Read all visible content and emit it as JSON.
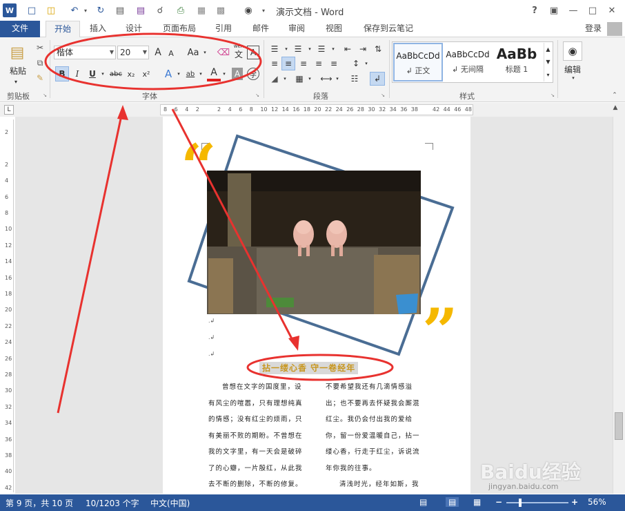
{
  "app": {
    "title": "演示文档 - Word",
    "help": "?",
    "login": "登录"
  },
  "tabs": [
    {
      "label": "文件"
    },
    {
      "label": "开始"
    },
    {
      "label": "插入"
    },
    {
      "label": "设计"
    },
    {
      "label": "页面布局"
    },
    {
      "label": "引用"
    },
    {
      "label": "邮件"
    },
    {
      "label": "审阅"
    },
    {
      "label": "视图"
    },
    {
      "label": "保存到云笔记"
    }
  ],
  "ribbon": {
    "clipboard": {
      "paste": "粘贴",
      "label": "剪贴板"
    },
    "font": {
      "name": "楷体",
      "size": "20",
      "label": "字体",
      "aa": "Aa",
      "bold": "B",
      "italic": "I",
      "underline": "U",
      "strike": "abc",
      "sub": "x₂",
      "sup": "x²",
      "wen": "wén",
      "wen_char": "文",
      "grow": "A",
      "shrink": "A",
      "font_color_a": "A",
      "text_effect_a": "A",
      "shade_a": "A",
      "highlight": "ab",
      "encircle": "字"
    },
    "paragraph": {
      "label": "段落"
    },
    "styles": {
      "label": "样式",
      "items": [
        {
          "sample": "AaBbCcDd",
          "name": "↲ 正文"
        },
        {
          "sample": "AaBbCcDd",
          "name": "↲ 无间隔"
        },
        {
          "sample": "AaBb",
          "name": "标题 1"
        }
      ]
    },
    "editing": {
      "label": "编辑"
    }
  },
  "ruler": {
    "h_ticks": [
      "8",
      "6",
      "4",
      "2",
      "",
      "2",
      "4",
      "6",
      "8",
      "10",
      "12",
      "14",
      "16",
      "18",
      "20",
      "22",
      "24",
      "26",
      "28",
      "30",
      "32",
      "34",
      "36",
      "38",
      "",
      "42",
      "44",
      "46",
      "48"
    ],
    "v_ticks": [
      "2",
      "",
      "2",
      "4",
      "6",
      "8",
      "10",
      "12",
      "14",
      "16",
      "18",
      "20",
      "22",
      "24",
      "26",
      "28",
      "30",
      "32",
      "34",
      "36",
      "38",
      "40",
      "42"
    ],
    "corner": "L"
  },
  "document": {
    "heading": "拈一缕心香 守一卷经年",
    "col_left": [
      "曾想在文字的国度里，设",
      "有风尘的喧嚣，只有理想纯真",
      "的情感；没有红尘的烦雨，只",
      "有美丽不败的期盼。不曾想在",
      "我的文字里，有一天会是破碎",
      "了的心瓣，一片殷红，从此我",
      "去不断的删除，不断的修复。"
    ],
    "col_right": [
      "不要希望我还有几滴情感溢",
      "出；也不要再去怀疑我会厮混",
      "红尘。我仍会付出我的爱给",
      "你，留一份爱温暖自己，拈一",
      "缕心香，行走于红尘，诉说流",
      "年你我的往事。",
      "清浅时光，经年如斯，我"
    ]
  },
  "status": {
    "page": "第 9 页，共 10 页",
    "words": "10/1203 个字",
    "lang": "中文(中国)",
    "zoom": "56%"
  },
  "watermark": {
    "brand": "Baidu经验",
    "url": "jingyan.baidu.com"
  },
  "colors": {
    "accent": "#2b579a",
    "annotation": "#e8322f",
    "quote": "#f5b800",
    "frame": "#4a6d94",
    "heading_text": "#c8961e"
  }
}
